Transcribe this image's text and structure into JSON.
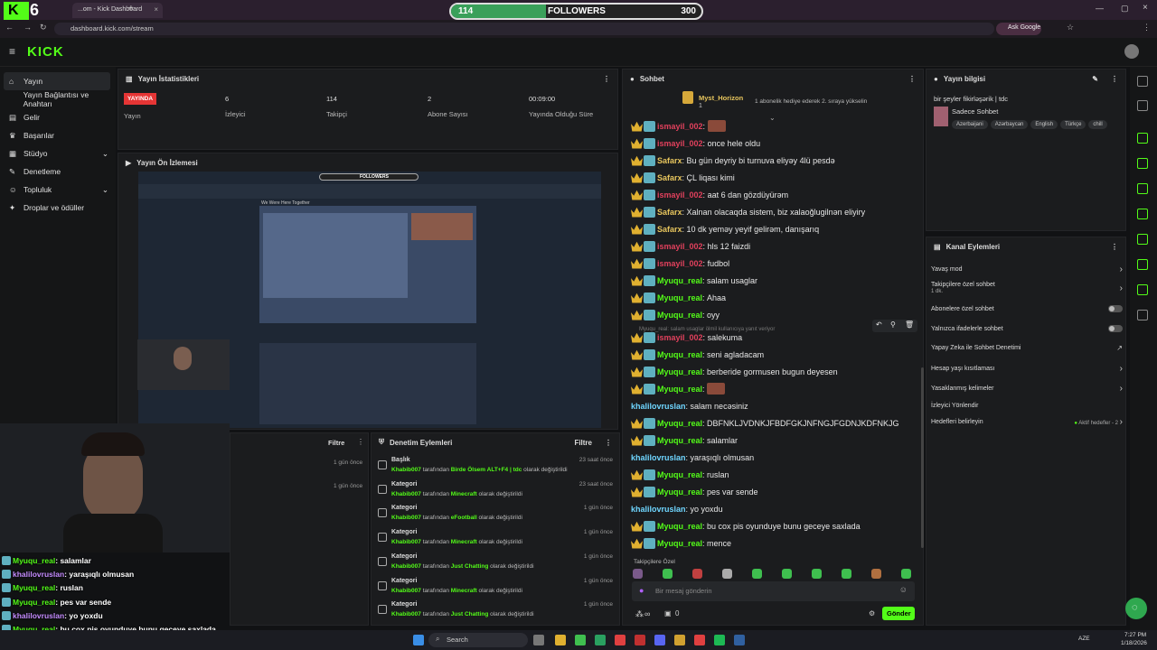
{
  "browser": {
    "tab_title": "...om - Kick Dashboard",
    "new_tab": "+",
    "url": "dashboard.kick.com/stream",
    "profile_label": "Ask Google"
  },
  "overlay": {
    "logo_number": "6",
    "followers_current": "114",
    "followers_label": "FOLLOWERS",
    "followers_goal": "300",
    "followers_progress": 0.38
  },
  "app": {
    "logo": "KICK"
  },
  "sidebar": {
    "items": [
      {
        "label": "Yayın",
        "icon": "home-icon"
      },
      {
        "label": "Yayın Bağlantısı ve Anahtarı",
        "icon": "none"
      },
      {
        "label": "Gelir",
        "icon": "wallet-icon"
      },
      {
        "label": "Başarılar",
        "icon": "trophy-icon"
      },
      {
        "label": "Stüdyo",
        "icon": "studio-icon",
        "chevron": "⌄"
      },
      {
        "label": "Denetleme",
        "icon": "wrench-icon"
      },
      {
        "label": "Topluluk",
        "icon": "users-icon",
        "chevron": "⌄"
      },
      {
        "label": "Droplar ve ödüller",
        "icon": "gift-icon"
      }
    ]
  },
  "stats": {
    "title": "Yayın İstatistikleri",
    "live_badge": "YAYINDA",
    "live_label": "Yayın",
    "viewers_value": "6",
    "viewers_label": "İzleyici",
    "followers_value": "114",
    "followers_label": "Takipçi",
    "subs_value": "2",
    "subs_label": "Abone Sayısı",
    "uptime_value": "00:09:00",
    "uptime_label": "Yayında Olduğu Süre"
  },
  "preview": {
    "title": "Yayın Ön İzlemesi",
    "followers_label": "FOLLOWERS",
    "hero_title": "We Were Here Together"
  },
  "filter_panel": {
    "filter_label": "Filtre",
    "times": [
      "1 gün önce",
      "1 gün önce"
    ]
  },
  "mod_actions": {
    "title": "Denetim Eylemleri",
    "filter_label": "Filtre",
    "rows": [
      {
        "title": "Başlık",
        "user": "Khabib007",
        "text1": "tarafından",
        "value": "Birde Ölsem ALT+F4 | tdc",
        "text2": "olarak değiştirildi",
        "time": "23 saat önce"
      },
      {
        "title": "Kategori",
        "user": "Khabib007",
        "text1": "tarafından",
        "value": "Minecraft",
        "text2": "olarak değiştirildi",
        "time": "23 saat önce"
      },
      {
        "title": "Kategori",
        "user": "Khabib007",
        "text1": "tarafından",
        "value": "eFootball",
        "text2": "olarak değiştirildi",
        "time": "1 gün önce"
      },
      {
        "title": "Kategori",
        "user": "Khabib007",
        "text1": "tarafından",
        "value": "Minecraft",
        "text2": "olarak değiştirildi",
        "time": "1 gün önce"
      },
      {
        "title": "Kategori",
        "user": "Khabib007",
        "text1": "tarafından",
        "value": "Just Chatting",
        "text2": "olarak değiştirildi",
        "time": "1 gün önce"
      },
      {
        "title": "Kategori",
        "user": "Khabib007",
        "text1": "tarafından",
        "value": "Minecraft",
        "text2": "olarak değiştirildi",
        "time": "1 gün önce"
      },
      {
        "title": "Kategori",
        "user": "Khabib007",
        "text1": "tarafından",
        "value": "Just Chatting",
        "text2": "olarak değiştirildi",
        "time": "1 gün önce"
      }
    ]
  },
  "chat": {
    "title": "Sohbet",
    "pinned_user": "Myst_Horizon",
    "pinned_count": "1",
    "pinned_text": "1 abonelik hediye ederek 2. sıraya yükselin",
    "reply_context": "Myuqu_real: salam usaglar ölmil kullanıcıya yanıt veriyor",
    "messages": [
      {
        "user": "ismayil_002",
        "color": "red",
        "text": "",
        "emote": true
      },
      {
        "user": "ismayil_002",
        "color": "red",
        "text": "once hele oldu"
      },
      {
        "user": "Safarx",
        "color": "gold",
        "text": "Bu gün deyriy bi turnuva eliyəy 4lü pesdə"
      },
      {
        "user": "Safarx",
        "color": "gold",
        "text": "ÇL liqası kimi"
      },
      {
        "user": "ismayil_002",
        "color": "red",
        "text": "aat 6 dan gözdüyürəm"
      },
      {
        "user": "Safarx",
        "color": "gold",
        "text": "Xalnan olacaqda sistem, biz xalaoğlugilnən eliyiry"
      },
      {
        "user": "Safarx",
        "color": "gold",
        "text": "10 dk yeməy yeyif gelirəm, danışarıq"
      },
      {
        "user": "ismayil_002",
        "color": "red",
        "text": "hls 12 faizdi"
      },
      {
        "user": "ismayil_002",
        "color": "red",
        "text": "fudbol"
      },
      {
        "user": "Myuqu_real",
        "color": "green",
        "text": "salam usaglar"
      },
      {
        "user": "Myuqu_real",
        "color": "green",
        "text": "Ahaa"
      },
      {
        "user": "Myuqu_real",
        "color": "green",
        "text": "oyy"
      },
      {
        "user": "ismayil_002",
        "color": "red",
        "text": "salekuma"
      },
      {
        "user": "Myuqu_real",
        "color": "green",
        "text": "seni agladacam"
      },
      {
        "user": "Myuqu_real",
        "color": "green",
        "text": "berberide gormusen bugun deyesen"
      },
      {
        "user": "Myuqu_real",
        "color": "green",
        "text": "",
        "emote": true
      },
      {
        "user": "khalilovruslan",
        "color": "cyan",
        "text": "salam necəsiniz",
        "nobadge": true
      },
      {
        "user": "Myuqu_real",
        "color": "green",
        "text": "DBFNKLJVDNKJFBDFGKJNFNGJFGDNJKDFNKJG"
      },
      {
        "user": "Myuqu_real",
        "color": "green",
        "text": "salamlar"
      },
      {
        "user": "khalilovruslan",
        "color": "cyan",
        "text": "yaraşıqlı olmusan",
        "nobadge": true
      },
      {
        "user": "Myuqu_real",
        "color": "green",
        "text": "ruslan"
      },
      {
        "user": "Myuqu_real",
        "color": "green",
        "text": "pes var sende"
      },
      {
        "user": "khalilovruslan",
        "color": "cyan",
        "text": "yo yoxdu",
        "nobadge": true
      },
      {
        "user": "Myuqu_real",
        "color": "green",
        "text": "bu cox pis oyunduye bunu geceye saxlada"
      },
      {
        "user": "Myuqu_real",
        "color": "green",
        "text": "mence"
      }
    ],
    "followers_only": "Takipçilere Özel",
    "input_placeholder": "Bir mesaj gönderin",
    "points_label": "∞",
    "gifts_label": "0",
    "send_label": "Gönder"
  },
  "stream_info": {
    "title": "Yayın bilgisi",
    "stream_title": "bir şeyler fikirləşərik | tdc",
    "category": "Sadece Sohbet",
    "tags": [
      "Azerbaijani",
      "Azərbaycan",
      "English",
      "Türkçe",
      "chill"
    ]
  },
  "channel_actions": {
    "title": "Kanal Eylemleri",
    "slow_mode": "Yavaş mod",
    "followers_only": "Takipçilere özel sohbet",
    "followers_only_sub": "1 dk.",
    "subs_only": "Abonelere özel sohbet",
    "emotes_only": "Yalnızca ifadelerle sohbet",
    "ai_mod": "Yapay Zeka ile Sohbet Denetimi",
    "account_limits": "Hesap yaşı kısıtlaması",
    "banned_words": "Yasaklanmış kelimeler",
    "redirect": "İzleyici Yönlendir",
    "goals": "Hedefleri belirleyin",
    "goals_status": "Aktif hedefler - 2"
  },
  "overlay_chat": [
    {
      "user": "Myuqu_real",
      "text": " : salamlar",
      "color": "#53fc18"
    },
    {
      "user": "khalilovruslan",
      "text": " : yaraşıqlı olmusan",
      "color": "#c58cff"
    },
    {
      "user": "Myuqu_real",
      "text": " : ruslan",
      "color": "#53fc18"
    },
    {
      "user": "Myuqu_real",
      "text": " : pes var sende",
      "color": "#53fc18"
    },
    {
      "user": "khalilovruslan",
      "text": " : yo yoxdu",
      "color": "#c58cff"
    },
    {
      "user": "Myuqu_real",
      "text": " : bu cox pis oyunduye bunu geceye saxlada",
      "color": "#53fc18"
    },
    {
      "user": "Myuqu_real",
      "text": " : mence",
      "color": "#53fc18"
    }
  ],
  "taskbar": {
    "search_label": "Search",
    "lang": "AZE",
    "time": "7:27 PM",
    "date": "1/18/2026"
  },
  "colors": {
    "accent": "#53fc18",
    "live": "#e53535"
  }
}
